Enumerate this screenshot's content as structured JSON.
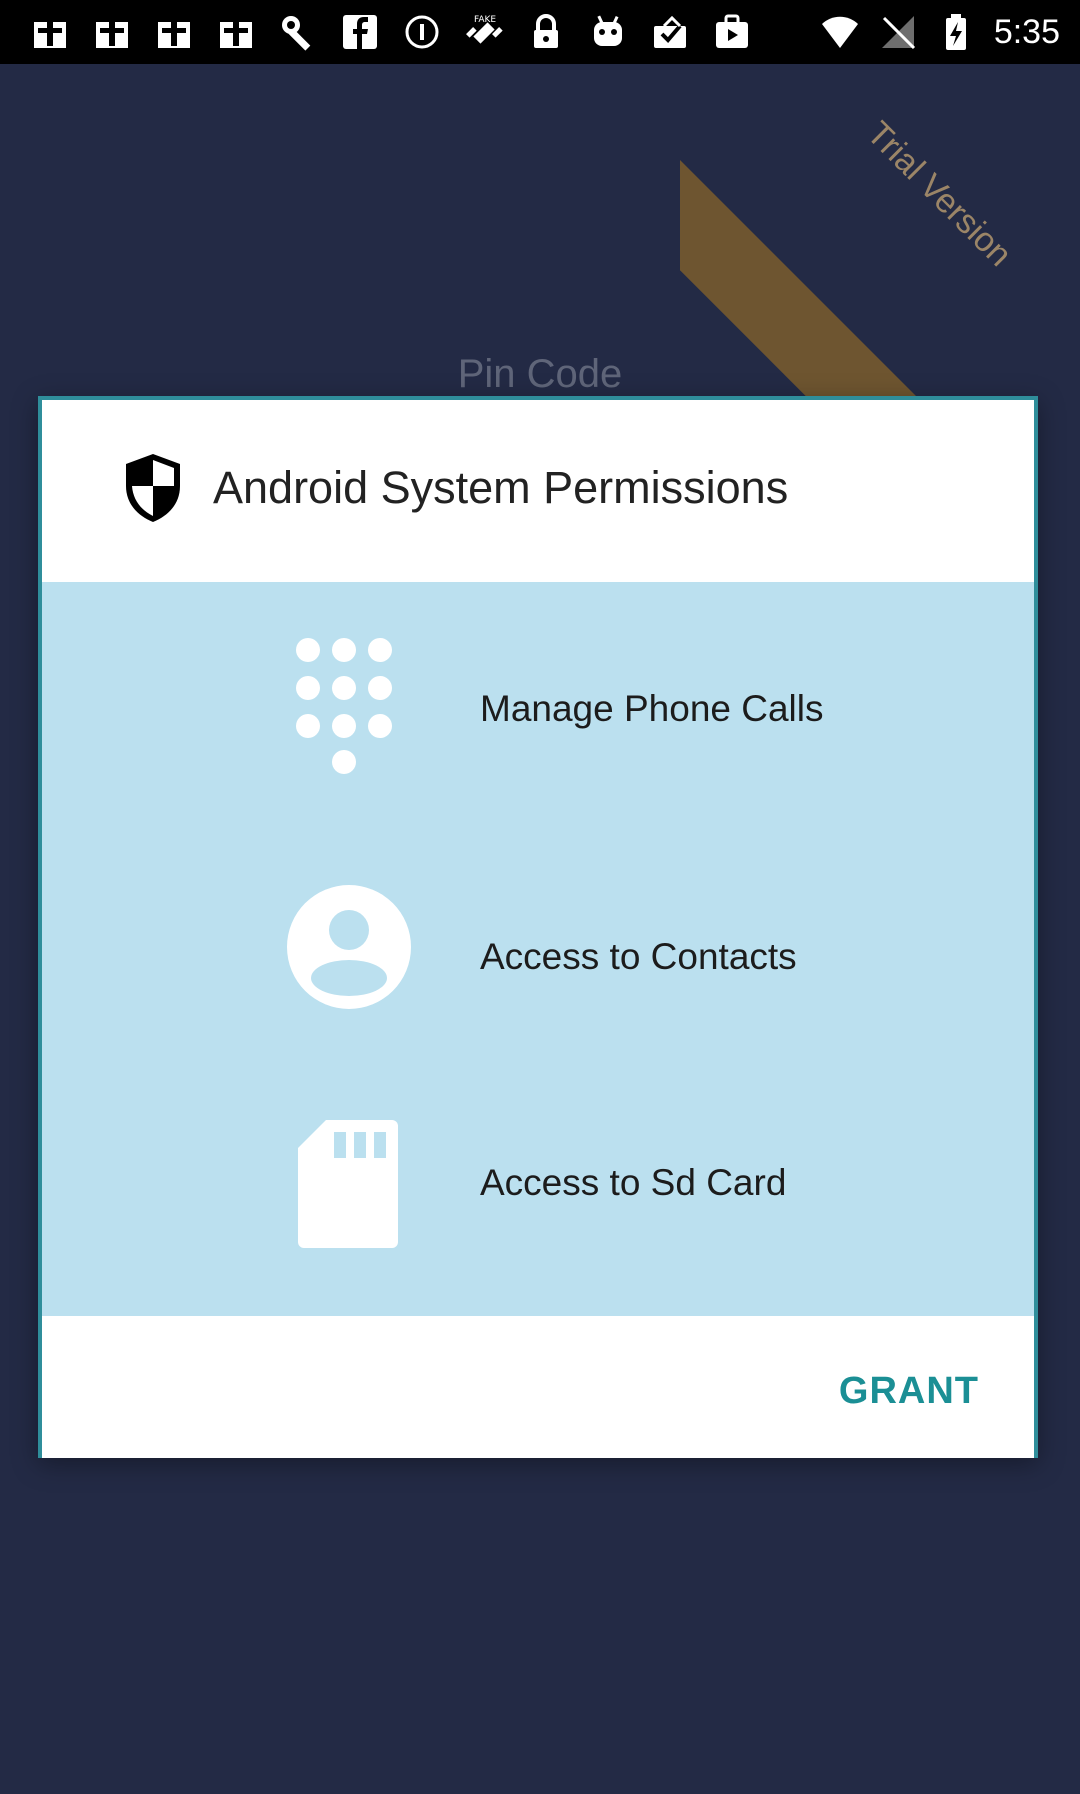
{
  "status_bar": {
    "time": "5:35",
    "left_icons": [
      "notification-icon",
      "notification-icon",
      "notification-icon",
      "notification-icon",
      "wrench-icon",
      "facebook-icon",
      "circle-i-icon",
      "fake-gps-icon",
      "lock-icon",
      "android-icon",
      "clipboard-check-icon",
      "play-icon"
    ],
    "right_icons": [
      "wifi-icon",
      "no-signal-icon",
      "battery-charging-icon"
    ]
  },
  "ribbon": {
    "label": "Trial Version",
    "color": "#6e5530"
  },
  "background": {
    "title": "Pin Code",
    "color": "#232a45"
  },
  "modal": {
    "title": "Android System Permissions",
    "header_icon": "shield-icon",
    "panel_color": "#bbe0ef",
    "permissions": [
      {
        "label": "Manage Phone Calls",
        "icon": "dialpad-icon"
      },
      {
        "label": "Access to Contacts",
        "icon": "contact-icon"
      },
      {
        "label": "Access to Sd Card",
        "icon": "sd-card-icon"
      }
    ],
    "grant_label": "GRANT",
    "accent_color": "#1b8f95"
  }
}
